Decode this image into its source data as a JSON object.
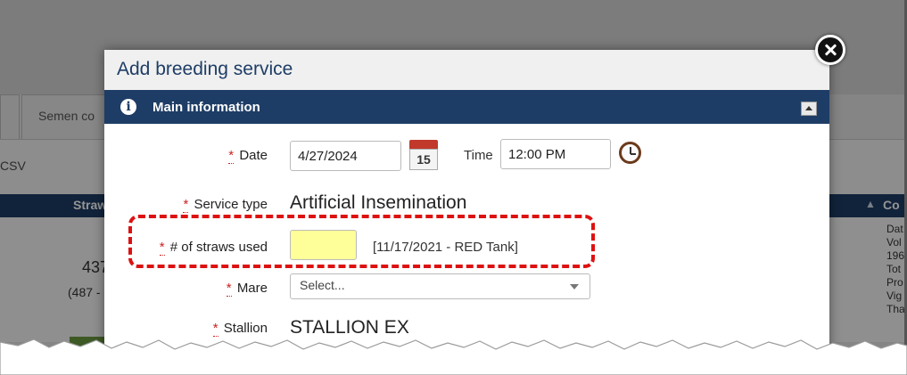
{
  "background": {
    "tabs": [
      "",
      "Semen co"
    ],
    "toolbar_text": "CSV",
    "table_headers": [
      "Straw",
      "Co"
    ],
    "row_value": "437",
    "row_sub": "(487 -",
    "side_lines": [
      "Dat",
      "Vol",
      "196",
      "Tot",
      "Pro",
      "Vig",
      "Tha"
    ]
  },
  "modal": {
    "title": "Add breeding service",
    "section": {
      "title": "Main information",
      "info_icon": "info-icon",
      "collapse_icon": "collapse-up-icon"
    },
    "required_marker": "*",
    "date": {
      "label": "Date",
      "value": "4/27/2024",
      "calendar_day": "15"
    },
    "time": {
      "label": "Time",
      "value": "12:00 PM"
    },
    "service_type": {
      "label": "Service type",
      "value": "Artificial Insemination"
    },
    "straws": {
      "label": "# of straws used",
      "value": "",
      "tank_note": "[11/17/2021 - RED Tank]",
      "input_color": "#ffff99"
    },
    "mare": {
      "label": "Mare",
      "placeholder": "Select..."
    },
    "stallion": {
      "label": "Stallion",
      "value": "STALLION EX"
    }
  },
  "colors": {
    "header_blue": "#1e3d66",
    "required_red": "#cc2222",
    "highlight_red": "#dd1111"
  }
}
